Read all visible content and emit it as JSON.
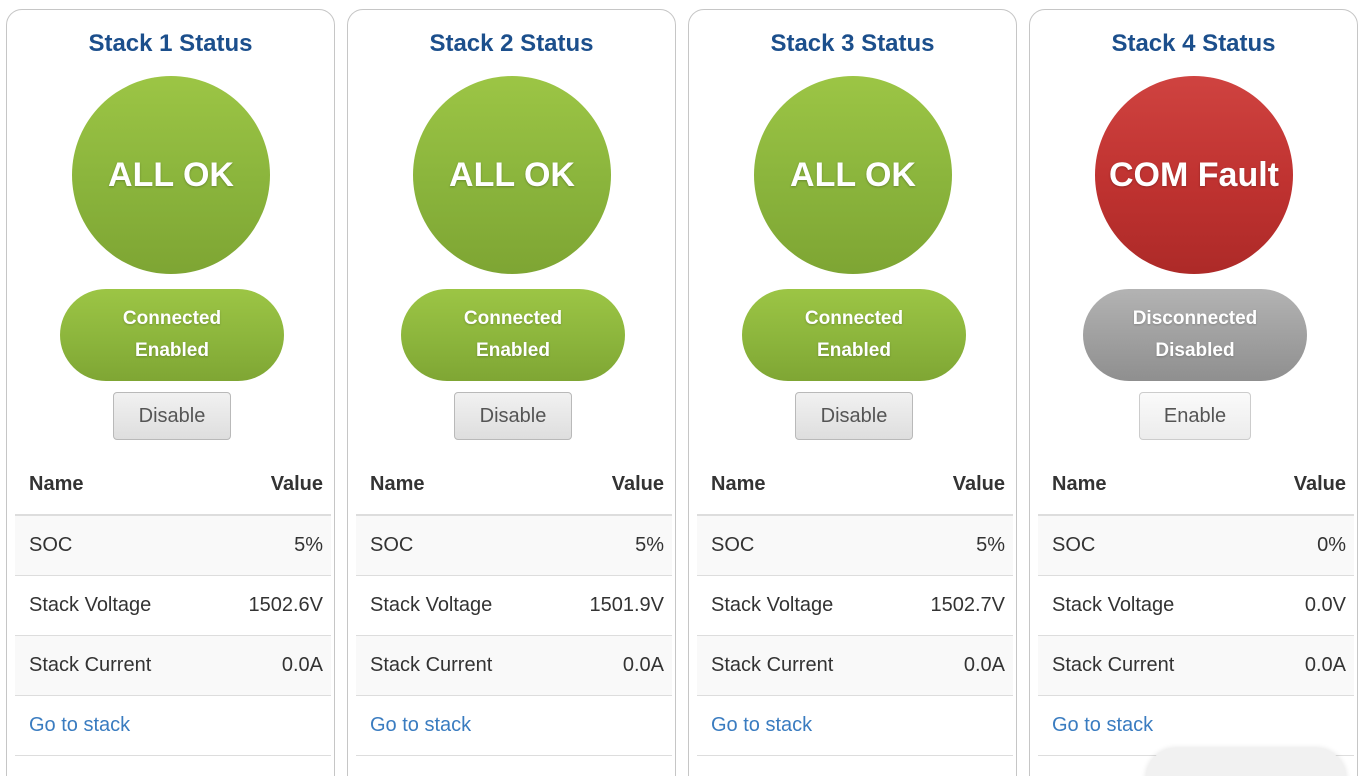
{
  "stacks": [
    {
      "title": "Stack 1 Status",
      "status": "ALL OK",
      "status_state": "ok",
      "connection": "Connected",
      "enabled": "Enabled",
      "conn_state": "ok",
      "button_label": "Disable",
      "table_header_name": "Name",
      "table_header_value": "Value",
      "rows": [
        {
          "name": "SOC",
          "value": "5%"
        },
        {
          "name": "Stack Voltage",
          "value": "1502.6V"
        },
        {
          "name": "Stack Current",
          "value": "0.0A"
        }
      ],
      "link_label": "Go to stack"
    },
    {
      "title": "Stack 2 Status",
      "status": "ALL OK",
      "status_state": "ok",
      "connection": "Connected",
      "enabled": "Enabled",
      "conn_state": "ok",
      "button_label": "Disable",
      "table_header_name": "Name",
      "table_header_value": "Value",
      "rows": [
        {
          "name": "SOC",
          "value": "5%"
        },
        {
          "name": "Stack Voltage",
          "value": "1501.9V"
        },
        {
          "name": "Stack Current",
          "value": "0.0A"
        }
      ],
      "link_label": "Go to stack"
    },
    {
      "title": "Stack 3 Status",
      "status": "ALL OK",
      "status_state": "ok",
      "connection": "Connected",
      "enabled": "Enabled",
      "conn_state": "ok",
      "button_label": "Disable",
      "table_header_name": "Name",
      "table_header_value": "Value",
      "rows": [
        {
          "name": "SOC",
          "value": "5%"
        },
        {
          "name": "Stack Voltage",
          "value": "1502.7V"
        },
        {
          "name": "Stack Current",
          "value": "0.0A"
        }
      ],
      "link_label": "Go to stack"
    },
    {
      "title": "Stack 4 Status",
      "status": "COM Fault",
      "status_state": "fault",
      "connection": "Disconnected",
      "enabled": "Disabled",
      "conn_state": "off",
      "button_label": "Enable",
      "table_header_name": "Name",
      "table_header_value": "Value",
      "rows": [
        {
          "name": "SOC",
          "value": "0%"
        },
        {
          "name": "Stack Voltage",
          "value": "0.0V"
        },
        {
          "name": "Stack Current",
          "value": "0.0A"
        }
      ],
      "link_label": "Go to stack"
    }
  ],
  "colors": {
    "title_blue": "#1c4f8c",
    "ok_green": "#8ab43c",
    "fault_red": "#bf3230",
    "disconnected_gray": "#9f9f9f",
    "link_blue": "#3a7cc0"
  }
}
